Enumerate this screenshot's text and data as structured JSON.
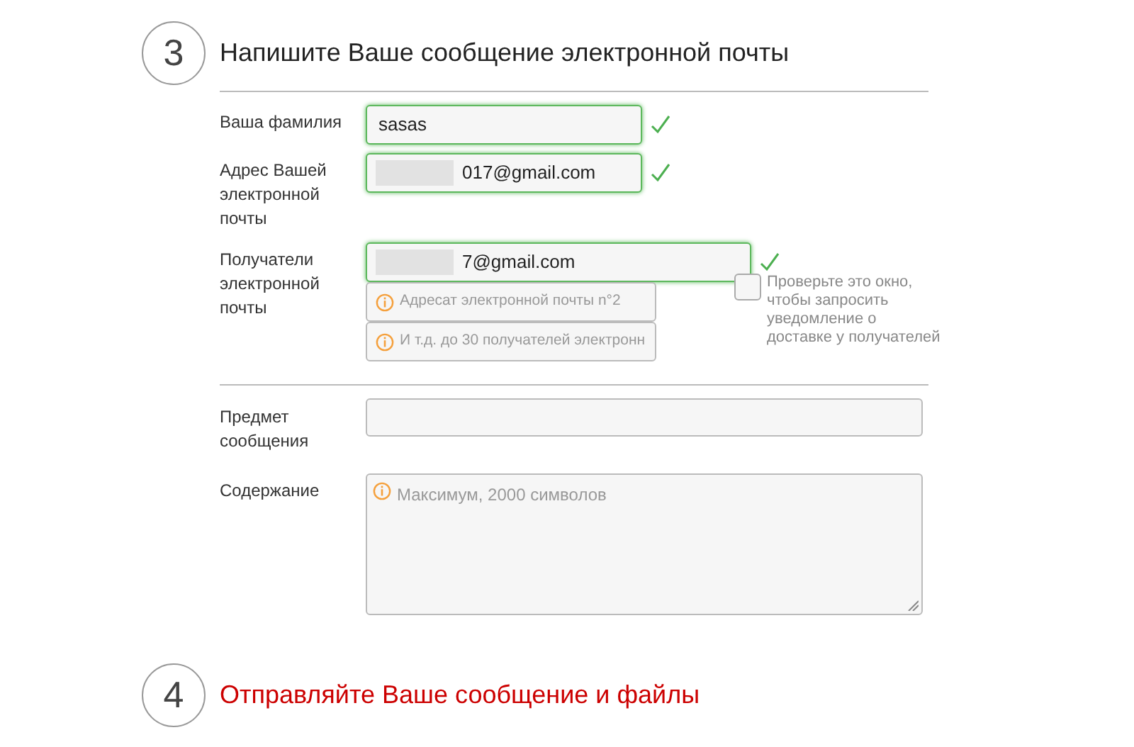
{
  "step3": {
    "number": "3",
    "title": "Напишите Ваше сообщение электронной почты",
    "active": false
  },
  "sender_fields": [
    {
      "label": "Ваша фамилия",
      "value": "sasas",
      "redacted": false,
      "valid": true
    },
    {
      "label": "Адрес Вашей электронной почты",
      "value": "017@gmail.com",
      "redacted": true,
      "valid": true
    }
  ],
  "recipients": {
    "label": "Получатели электронной почты",
    "fields": [
      {
        "value": "7@gmail.com",
        "redacted": true,
        "valid": true
      },
      {
        "placeholder": "Адресат электронной почты n°2",
        "valid": false
      },
      {
        "placeholder": "И т.д. до 30 получателей электронн",
        "valid": false
      }
    ],
    "receipt_checkbox": {
      "checked": false,
      "note": "Проверьте это окно, чтобы запросить уведомление о доставке у получателей"
    }
  },
  "subject": {
    "label": "Предмет сообщения"
  },
  "content": {
    "label": "Содержание",
    "placeholder": "Максимум, 2000 символов"
  },
  "step4": {
    "number": "4",
    "title": "Отправляйте Ваше сообщение и файлы",
    "active": true
  }
}
